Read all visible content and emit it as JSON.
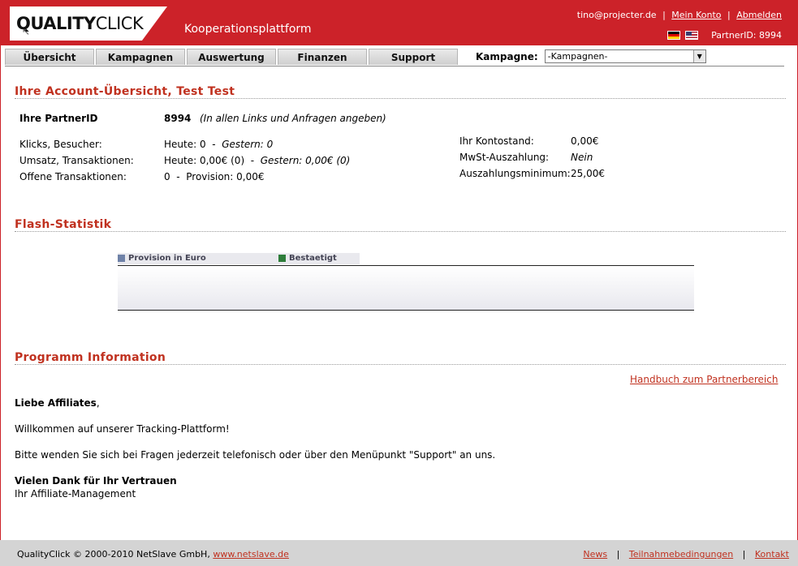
{
  "header": {
    "logo_bold": "QUALITY",
    "logo_thin": "CLICK",
    "tagline": "Kooperationsplattform",
    "user_email": "tino@projecter.de",
    "my_account": "Mein Konto",
    "logout": "Abmelden",
    "partner_id_text": "PartnerID: 8994",
    "brand_color": "#cc2229"
  },
  "nav": {
    "tabs": [
      "Übersicht",
      "Kampagnen",
      "Auswertung",
      "Finanzen",
      "Support"
    ],
    "campaign_label": "Kampagne:",
    "campaign_selected": "-Kampagnen-"
  },
  "overview": {
    "title": "Ihre Account-Übersicht, Test Test",
    "partner_label": "Ihre PartnerID",
    "partner_value": "8994",
    "partner_note": "(In allen Links und Anfragen angeben)",
    "clicks_label": "Klicks, Besucher:",
    "clicks_today": "Heute: 0",
    "clicks_yesterday": "Gestern: 0",
    "sales_label": "Umsatz, Transaktionen:",
    "sales_today": "Heute: 0,00€ (0)",
    "sales_yesterday": "Gestern: 0,00€ (0)",
    "open_label": "Offene Transaktionen:",
    "open_value": "0",
    "open_provision": "Provision: 0,00€",
    "dash": "-",
    "balance_label": "Ihr Kontostand:",
    "balance_value": "0,00€",
    "vat_label": "MwSt-Auszahlung:",
    "vat_value": "Nein",
    "minimum_label": "Auszahlungsminimum:",
    "minimum_value": "25,00€"
  },
  "flash": {
    "title": "Flash-Statistik"
  },
  "chart_data": {
    "type": "area",
    "series": [
      {
        "name": "Provision in Euro",
        "color": "#6f82a8",
        "values": []
      },
      {
        "name": "Bestaetigt",
        "color": "#2e7d3a",
        "values": []
      }
    ]
  },
  "program": {
    "title": "Programm Information",
    "manual_link": "Handbuch zum Partnerbereich",
    "greeting_bold": "Liebe Affiliates",
    "greeting_comma": ",",
    "welcome": "Willkommen auf unserer Tracking-Plattform!",
    "support_text": "Bitte wenden Sie sich bei Fragen jederzeit telefonisch oder über den Menüpunkt \"Support\" an uns.",
    "thanks": "Vielen Dank für Ihr Vertrauen",
    "signature": "Ihr Affiliate-Management"
  },
  "footer": {
    "copyright": "QualityClick © 2000-2010 NetSlave GmbH,",
    "website": "www.netslave.de",
    "news": "News",
    "terms": "Teilnahmebedingungen",
    "contact": "Kontakt",
    "sep": "|"
  }
}
